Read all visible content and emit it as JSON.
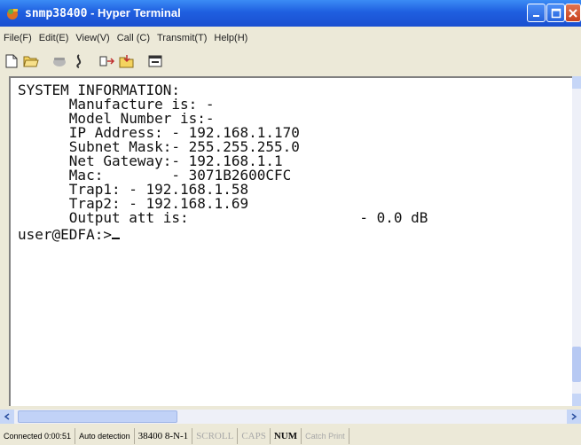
{
  "window": {
    "title_prefix": "snmp38400",
    "title_suffix": " - Hyper Terminal"
  },
  "menu": [
    "File(F)",
    "Edit(E)",
    "View(V)",
    "Call (C)",
    "Transmit(T)",
    "Help(H)"
  ],
  "toolbar": {
    "icons": [
      "new-document-icon",
      "open-folder-icon",
      "phone-icon",
      "disconnect-icon",
      "send-icon",
      "receive-icon",
      "properties-icon"
    ]
  },
  "terminal": {
    "lines": [
      "SYSTEM INFORMATION:",
      "      Manufacture is: -",
      "      Model Number is:-",
      "      IP Address: - 192.168.1.170",
      "      Subnet Mask:- 255.255.255.0",
      "      Net Gateway:- 192.168.1.1",
      "      Mac:        - 3071B2600CFC",
      "      Trap1: - 192.168.1.58",
      "      Trap2: - 192.168.1.69",
      "      Output att is:                    - 0.0 dB"
    ],
    "prompt": "user@EDFA:>"
  },
  "status": {
    "connected": "Connected 0:00:51",
    "detection": "Auto detection",
    "port": "38400 8-N-1",
    "scroll": "SCROLL",
    "caps": "CAPS",
    "num": "NUM",
    "catch": "Catch",
    "print": "Print"
  }
}
